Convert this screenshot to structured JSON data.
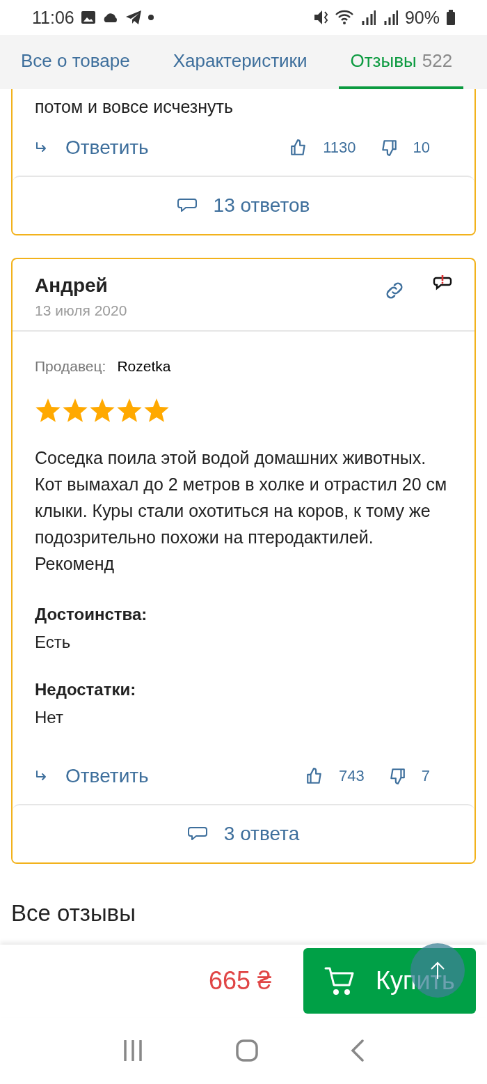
{
  "status_bar": {
    "time": "11:06",
    "battery": "90%"
  },
  "tabs": [
    {
      "label": "Все о товаре",
      "selected": false
    },
    {
      "label": "Характеристики",
      "selected": false
    },
    {
      "label": "Отзывы",
      "count": "522",
      "selected": true
    }
  ],
  "reviews": [
    {
      "text_tail": "потом и вовсе исчезнуть",
      "reply": "Ответить",
      "likes": "1130",
      "dislikes": "10",
      "replies": "13 ответов"
    },
    {
      "author": "Андрей",
      "date": "13 июля 2020",
      "seller_label": "Продавец:",
      "seller": "Rozetka",
      "stars": 5,
      "text": "Соседка поила этой водой домашних животных. Кот вымахал до 2 метров в холке и отрастил 20 см клыки. Куры стали охотиться на коров, к тому же подозрительно похожи на птеродактилей. Рекоменд",
      "pros_label": "Достоинства:",
      "pros": "Есть",
      "cons_label": "Недостатки:",
      "cons": "Нет",
      "reply": "Ответить",
      "likes": "743",
      "dislikes": "7",
      "replies": "3 ответа"
    }
  ],
  "all_reviews_title": "Все отзывы",
  "buy_bar": {
    "price": "665 ₴",
    "buy": "Купить"
  }
}
